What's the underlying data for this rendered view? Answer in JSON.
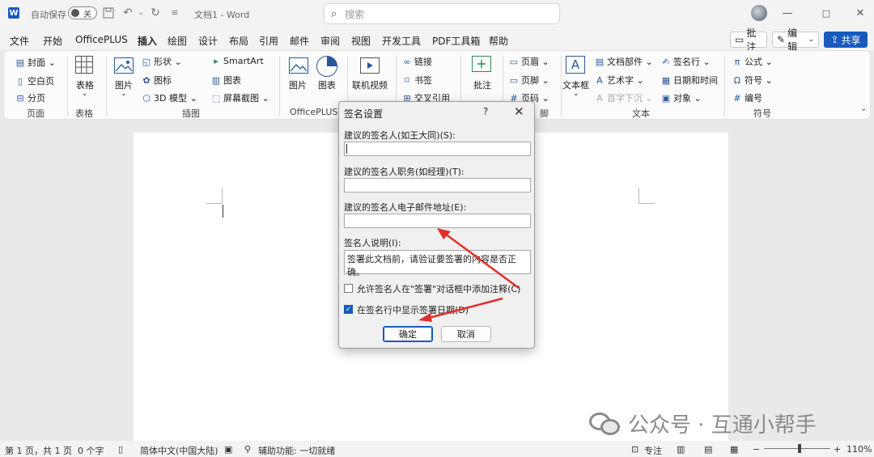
{
  "titlebar": {
    "autosave_label": "自动保存",
    "autosave_state": "关",
    "doc_title": "文档1 - Word",
    "search_placeholder": "搜索"
  },
  "menu": {
    "tabs": [
      "文件",
      "开始",
      "OfficePLUS",
      "插入",
      "绘图",
      "设计",
      "布局",
      "引用",
      "邮件",
      "审阅",
      "视图",
      "开发工具",
      "PDF工具箱",
      "帮助"
    ],
    "active_tab": "插入",
    "comment_btn": "批注",
    "edit_btn": "编辑",
    "share_btn": "共享"
  },
  "ribbon": {
    "pages": {
      "cover": "封面",
      "blank": "空白页",
      "break": "分页",
      "label": "页面"
    },
    "table": {
      "btn": "表格",
      "label": "表格"
    },
    "illustrations": {
      "picture": "图片",
      "shapes": "形状",
      "icons": "图标",
      "model3d": "3D 模型",
      "smartart": "SmartArt",
      "chart": "图表",
      "screenshot": "屏幕截图",
      "label": "插图"
    },
    "officeplus": {
      "picture": "图片",
      "chart": "图表",
      "label": "OfficePLUS"
    },
    "media": {
      "video": "联机视频"
    },
    "links": {
      "link": "链接",
      "bookmark": "书签",
      "crossref": "交叉引用"
    },
    "comments": {
      "btn": "批注"
    },
    "headerfooter": {
      "header": "页眉",
      "footer": "页脚",
      "pagenum": "页码",
      "label": "脚"
    },
    "text": {
      "textbox": "文本框",
      "parts": "文档部件",
      "wordart": "艺术字",
      "dropcap": "首字下沉",
      "sigline": "签名行",
      "datetime": "日期和时间",
      "object": "对象",
      "label": "文本"
    },
    "symbols": {
      "equation": "公式",
      "symbol": "符号",
      "number": "编号",
      "label": "符号"
    }
  },
  "dialog": {
    "title": "签名设置",
    "help": "?",
    "signer_label": "建议的签名人(如王大同)(S):",
    "signer_value": "",
    "title_label": "建议的签名人职务(如经理)(T):",
    "title_value": "",
    "email_label": "建议的签名人电子邮件地址(E):",
    "email_value": "",
    "instructions_label": "签名人说明(I):",
    "instructions_value": "签署此文档前，请验证要签署的内容是否正确。",
    "allow_comments_label": "允许签名人在\"签署\"对话框中添加注释(C)",
    "allow_comments_checked": false,
    "show_date_label": "在签名行中显示签署日期(D)",
    "show_date_checked": true,
    "ok": "确定",
    "cancel": "取消"
  },
  "statusbar": {
    "page": "第 1 页，共 1 页",
    "words": "0 个字",
    "language": "简体中文(中国大陆)",
    "accessibility": "辅助功能: 一切就绪",
    "focus": "专注",
    "zoom": "110%",
    "zoom_level": 0.55
  },
  "watermark": {
    "text": "公众号 · 互通小帮手"
  },
  "colors": {
    "accent": "#185abd",
    "arrow": "#e0302b"
  },
  "icons": [
    "word-logo-icon",
    "save-icon",
    "undo-icon",
    "redo-icon",
    "search-icon",
    "minimize-icon",
    "maximize-icon",
    "close-icon",
    "wechat-icon"
  ]
}
